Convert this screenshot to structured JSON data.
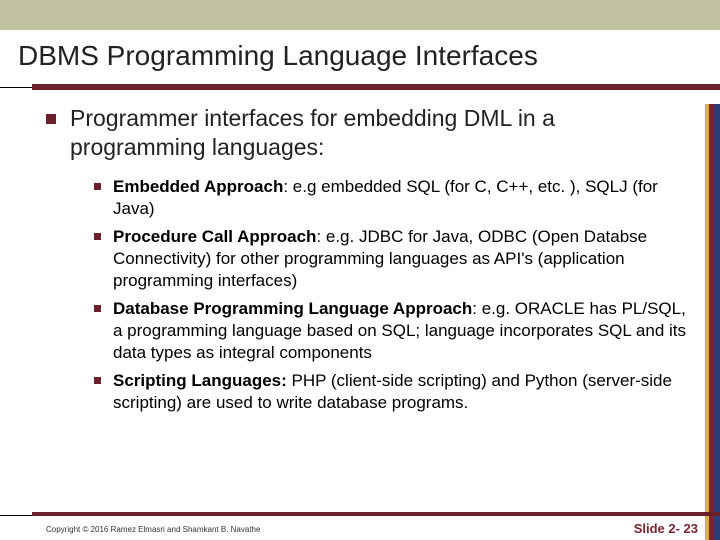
{
  "title": "DBMS Programming Language Interfaces",
  "main_point": "Programmer interfaces for embedding DML in a programming languages:",
  "sub": [
    {
      "bold": "Embedded Approach",
      "rest": ": e.g embedded SQL (for C, C++, etc. ), SQLJ (for Java)"
    },
    {
      "bold": "Procedure Call Approach",
      "rest": ": e.g. JDBC for Java, ODBC (Open Databse Connectivity) for other programming languages as API's (application programming interfaces)"
    },
    {
      "bold": "Database Programming Language Approach",
      "rest": ": e.g. ORACLE has PL/SQL, a programming language based on SQL; language incorporates SQL and its data types as integral components"
    },
    {
      "bold": "Scripting Languages:",
      "rest": " PHP (client-side scripting) and Python (server-side scripting) are used to write database programs."
    }
  ],
  "copyright": "Copyright © 2016 Ramez Elmasri and Shamkant B. Navathe",
  "slide_num": "Slide 2- 23"
}
